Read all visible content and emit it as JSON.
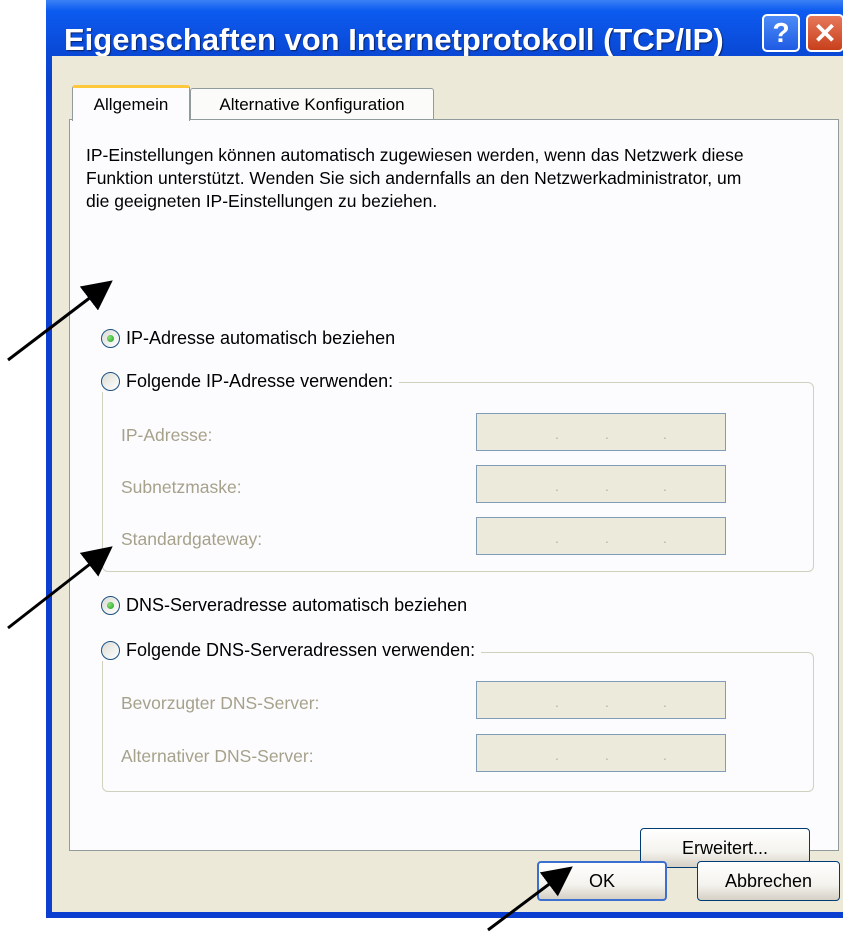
{
  "window": {
    "title": "Eigenschaften von Internetprotokoll (TCP/IP)",
    "help_label": "?",
    "close_label": "✕"
  },
  "tabs": [
    {
      "label": "Allgemein",
      "active": true
    },
    {
      "label": "Alternative Konfiguration",
      "active": false
    }
  ],
  "description": "IP-Einstellungen können automatisch zugewiesen werden, wenn das Netzwerk diese Funktion unterstützt. Wenden Sie sich andernfalls an den Netzwerkadministrator, um die geeigneten IP-Einstellungen zu beziehen.",
  "ip_section": {
    "auto_label": "IP-Adresse automatisch beziehen",
    "auto_selected": true,
    "manual_label": "Folgende IP-Adresse verwenden:",
    "manual_selected": false,
    "fields": [
      {
        "label": "IP-Adresse:",
        "value": ""
      },
      {
        "label": "Subnetzmaske:",
        "value": ""
      },
      {
        "label": "Standardgateway:",
        "value": ""
      }
    ]
  },
  "dns_section": {
    "auto_label": "DNS-Serveradresse automatisch beziehen",
    "auto_selected": true,
    "manual_label": "Folgende DNS-Serveradressen verwenden:",
    "manual_selected": false,
    "fields": [
      {
        "label": "Bevorzugter DNS-Server:",
        "value": ""
      },
      {
        "label": "Alternativer DNS-Server:",
        "value": ""
      }
    ]
  },
  "buttons": {
    "advanced": "Erweitert...",
    "ok": "OK",
    "cancel": "Abbrechen"
  },
  "colors": {
    "title_bar": "#0a4ad8",
    "dialog_bg": "#ece9d8",
    "active_tab_accent": "#ffc83c",
    "radio_dot": "#21a121"
  }
}
